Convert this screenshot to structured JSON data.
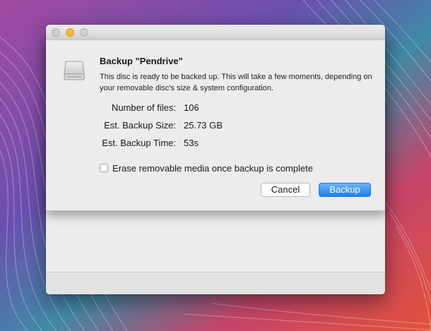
{
  "colors": {
    "accent": "#1c7ff3",
    "minimize": "#f6b93b",
    "sheet_background": "#ececec"
  },
  "window": {
    "controls": [
      "close",
      "minimize",
      "zoom"
    ]
  },
  "sheet": {
    "icon": "removable-drive-icon",
    "title": "Backup \"Pendrive\"",
    "description": "This disc is ready to be backed up. This will take a few moments, depending on your removable disc's size & system configuration.",
    "info": [
      {
        "label": "Number of files:",
        "value": "106"
      },
      {
        "label": "Est. Backup Size:",
        "value": "25.73 GB"
      },
      {
        "label": "Est. Backup Time:",
        "value": "53s"
      }
    ],
    "erase_option": {
      "label": "Erase removable media once backup is complete",
      "checked": false
    },
    "buttons": {
      "cancel": "Cancel",
      "backup": "Backup"
    }
  }
}
